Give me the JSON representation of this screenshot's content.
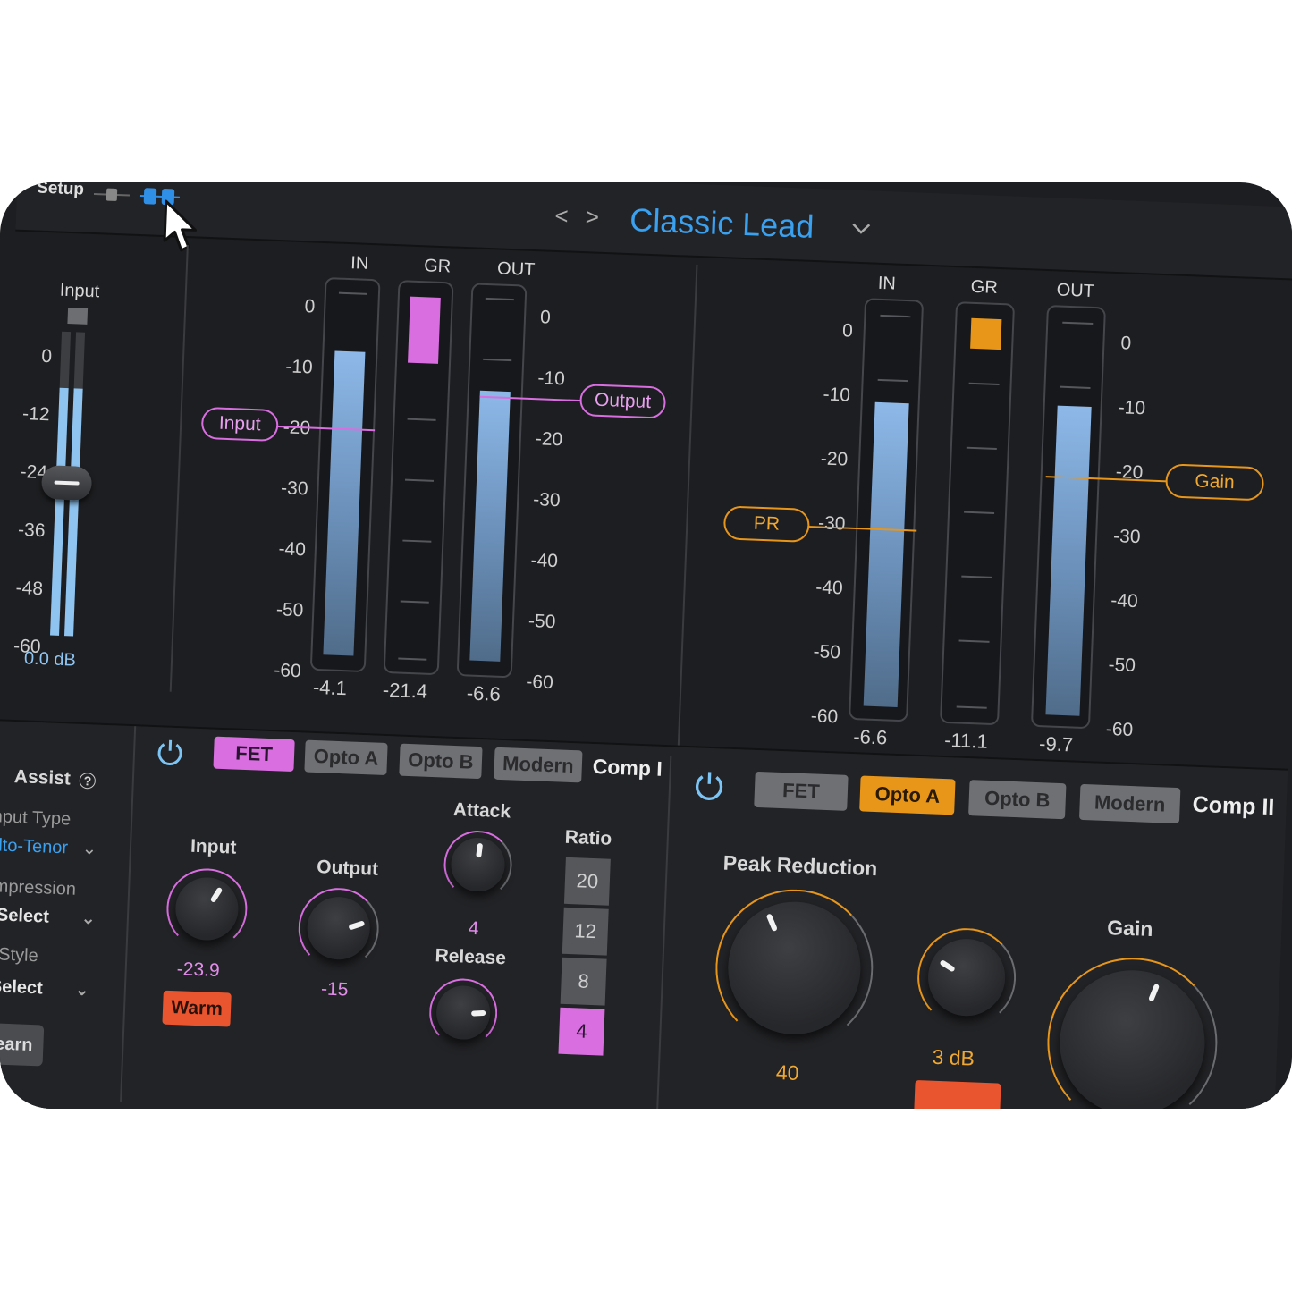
{
  "header": {
    "setup_label": "Setup",
    "preset_name": "Classic Lead",
    "prev_next_label": "< >",
    "preset_dropdown": "chevron-down-icon"
  },
  "sidebar": {
    "input_label": "Input",
    "scale": [
      "0",
      "-12",
      "-24",
      "-36",
      "-48",
      "-60"
    ],
    "value": "0.0 dB",
    "assist_label": "Assist",
    "input_type_label": "Input Type",
    "input_type_value": "Alto-Tenor",
    "compression_label": "Compression",
    "compression_value": "Select",
    "style_label": "Style",
    "style_value": "Select",
    "learn_label": "Learn"
  },
  "comp1_meters": {
    "in_label": "IN",
    "gr_label": "GR",
    "out_label": "OUT",
    "scale_left": [
      "0",
      "-10",
      "-20",
      "-30",
      "-40",
      "-50",
      "-60"
    ],
    "scale_right": [
      "0",
      "-10",
      "-20",
      "-30",
      "-40",
      "-50",
      "-60"
    ],
    "in_value": "-4.1",
    "gr_value": "-21.4",
    "out_value": "-6.6",
    "input_tag": "Input",
    "output_tag": "Output"
  },
  "comp2_meters": {
    "in_label": "IN",
    "gr_label": "GR",
    "out_label": "OUT",
    "scale_left": [
      "0",
      "-10",
      "-20",
      "-30",
      "-40",
      "-50",
      "-60"
    ],
    "scale_right": [
      "0",
      "-10",
      "-20",
      "-30",
      "-40",
      "-50",
      "-60"
    ],
    "in_value": "-6.6",
    "gr_value": "-11.1",
    "out_value": "-9.7",
    "pr_tag": "PR",
    "gain_tag": "Gain"
  },
  "comp1": {
    "types": [
      "FET",
      "Opto A",
      "Opto B",
      "Modern"
    ],
    "active_type": "FET",
    "title": "Comp I",
    "input_label": "Input",
    "input_value": "-23.9",
    "warm_label": "Warm",
    "output_label": "Output",
    "output_value": "-15",
    "attack_label": "Attack",
    "attack_value": "4",
    "release_label": "Release",
    "ratio_label": "Ratio",
    "ratios": [
      "20",
      "12",
      "8",
      "4"
    ],
    "active_ratio": "4",
    "accent": "#d86ee0"
  },
  "comp2": {
    "types": [
      "FET",
      "Opto A",
      "Opto B",
      "Modern"
    ],
    "active_type": "Opto A",
    "title": "Comp II",
    "peak_reduction_label": "Peak Reduction",
    "peak_reduction_value": "40",
    "mid_value": "3 dB",
    "gain_label": "Gain",
    "accent": "#e8961a"
  },
  "colors": {
    "title_blue": "#3aa0f0",
    "warm_red": "#e8552e"
  }
}
